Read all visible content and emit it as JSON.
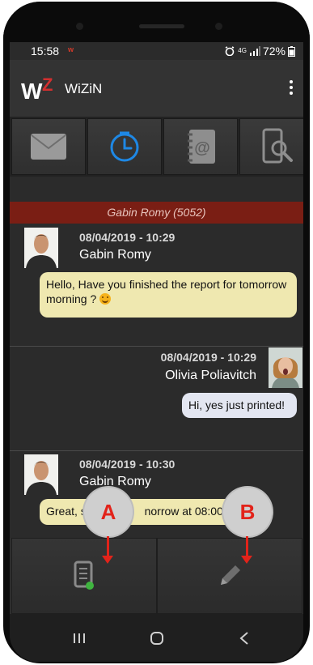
{
  "status": {
    "time": "15:58",
    "notif_icon": "w-icon",
    "network": "4G",
    "battery": "72%"
  },
  "app": {
    "title": "WiZiN",
    "logo_text": "WZ"
  },
  "tabs": [
    {
      "name": "mail-icon",
      "active": false
    },
    {
      "name": "clock-icon",
      "active": true
    },
    {
      "name": "address-book-icon",
      "active": false
    },
    {
      "name": "phone-search-icon",
      "active": false
    }
  ],
  "conversation": {
    "title": "Gabin Romy (5052)"
  },
  "messages": [
    {
      "date": "08/04/2019 - 10:29",
      "sender": "Gabin Romy",
      "text": "Hello, Have you finished the report for tomorrow morning ?",
      "direction": "incoming"
    },
    {
      "date": "08/04/2019 - 10:29",
      "sender": "Olivia Poliavitch",
      "text": "Hi, yes just printed!",
      "direction": "outgoing"
    },
    {
      "date": "08/04/2019 - 10:30",
      "sender": "Gabin Romy",
      "text_left": "Great, s",
      "text_right": "norrow at 08:00",
      "direction": "incoming"
    }
  ],
  "callouts": {
    "a": "A",
    "b": "B"
  },
  "actions": [
    {
      "name": "templates-icon"
    },
    {
      "name": "compose-icon"
    }
  ],
  "nav": [
    {
      "name": "recent-apps-icon",
      "glyph": "|||"
    },
    {
      "name": "home-icon",
      "glyph": "○"
    },
    {
      "name": "back-icon",
      "glyph": "<"
    }
  ],
  "colors": {
    "accent": "#1e88e5",
    "header_red": "#7a1e14",
    "callout_red": "#e2231a",
    "bubble_in": "#efe8b0",
    "bubble_out": "#e3e6f1"
  }
}
